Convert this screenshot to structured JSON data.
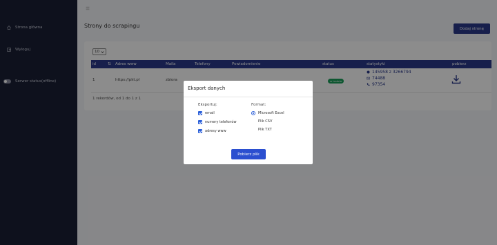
{
  "sidebar": {
    "items": [
      {
        "label": "Strona główna",
        "icon": "home-icon"
      },
      {
        "label": "Wyloguj",
        "icon": "logout-icon"
      }
    ],
    "status_toggle": {
      "label": "Serwer status(offline)"
    }
  },
  "topbar": {
    "icon": "menu-icon"
  },
  "page": {
    "title": "Strony do scrapingu",
    "add_button": "Dodaj stronę",
    "page_size": "10",
    "table": {
      "headers": [
        "id",
        "Adres www",
        "Maila",
        "Telefony",
        "Powiadomienie",
        "status",
        "statystyki",
        "pobierz"
      ],
      "rows": [
        {
          "id": "1",
          "url": "https://pkt.pl",
          "mails": "zbiora",
          "status": "w trakcie",
          "stats": {
            "sites": "145958 z 3266794",
            "emails": "74488",
            "phones": "97354"
          }
        }
      ]
    },
    "footer_info": "1 rekordów, od 1 do 1 z 1"
  },
  "modal": {
    "title": "Eksport danych",
    "export_label": "Eksportuj:",
    "export_options": [
      "email",
      "numery telefonów",
      "adresy www"
    ],
    "format_label": "Format:",
    "format_options": [
      "Microsoft Excel",
      "Plik CSV",
      "Plik TXT"
    ],
    "selected_format": "Microsoft Excel",
    "submit_button": "Pobierz plik"
  },
  "colors": {
    "sidebar_bg": "#1b2035",
    "table_header": "#2a3a8a",
    "primary_button": "#2b4fd0",
    "status_badge": "#1b9e5a"
  }
}
